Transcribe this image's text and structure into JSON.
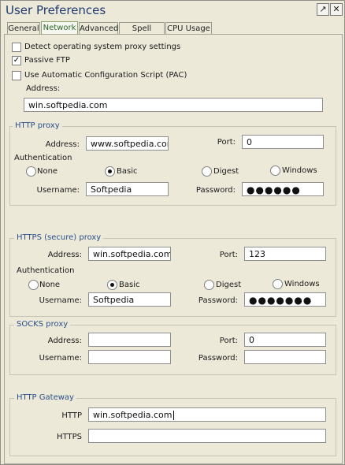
{
  "window": {
    "title": "User Preferences",
    "pin_glyph": "↗",
    "close_glyph": "✕"
  },
  "tabs": [
    "General",
    "Network",
    "Advanced",
    "Spell Check",
    "CPU Usage"
  ],
  "general": {
    "detect_proxy_label": "Detect operating system proxy settings",
    "detect_proxy_checked": false,
    "passive_ftp_label": "Passive FTP",
    "passive_ftp_checked": true,
    "pac_label": "Use Automatic Configuration Script (PAC)",
    "pac_checked": false,
    "address_label": "Address:",
    "address_value": "win.softpedia.com"
  },
  "http_proxy": {
    "legend": "HTTP proxy",
    "address_label": "Address:",
    "address_value": "www.softpedia.com",
    "port_label": "Port:",
    "port_value": "0",
    "auth_label": "Authentication",
    "auth_options": [
      "None",
      "Basic",
      "Digest",
      "Windows"
    ],
    "auth_selected": "Basic",
    "username_label": "Username:",
    "username_value": "Softpedia",
    "password_label": "Password:",
    "password_value": "●●●●●●"
  },
  "https_proxy": {
    "legend": "HTTPS (secure) proxy",
    "address_label": "Address:",
    "address_value": "win.softpedia.com",
    "port_label": "Port:",
    "port_value": "123",
    "auth_label": "Authentication",
    "auth_options": [
      "None",
      "Basic",
      "Digest",
      "Windows"
    ],
    "auth_selected": "Basic",
    "username_label": "Username:",
    "username_value": "Softpedia",
    "password_label": "Password:",
    "password_value": "●●●●●●●"
  },
  "socks_proxy": {
    "legend": "SOCKS proxy",
    "address_label": "Address:",
    "address_value": "",
    "port_label": "Port:",
    "port_value": "0",
    "username_label": "Username:",
    "username_value": "",
    "password_label": "Password:",
    "password_value": ""
  },
  "http_gateway": {
    "legend": "HTTP Gateway",
    "http_label": "HTTP",
    "http_value": "win.softpedia.com",
    "https_label": "HTTPS",
    "https_value": ""
  }
}
